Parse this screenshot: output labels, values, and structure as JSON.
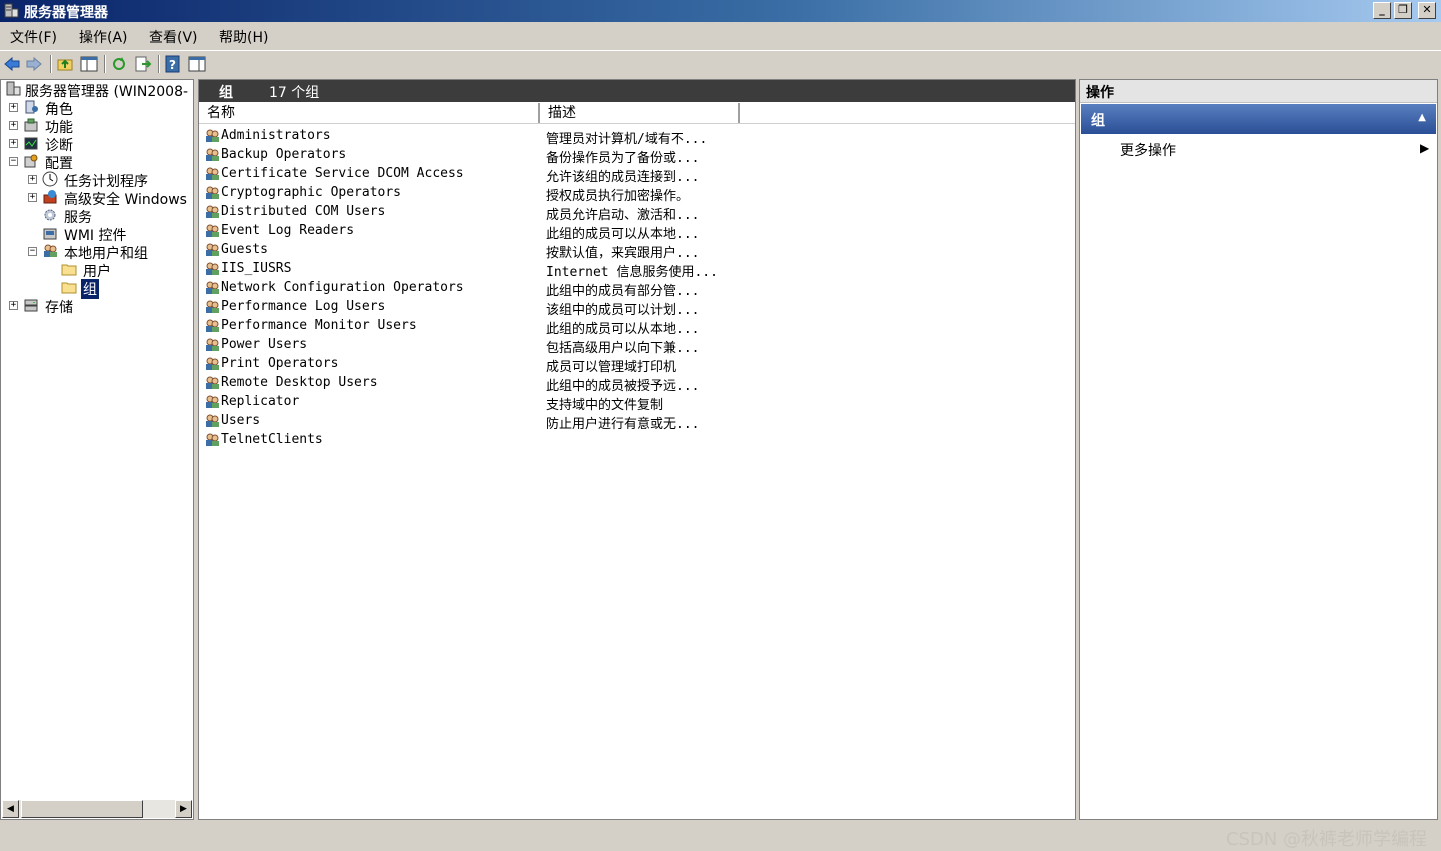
{
  "window": {
    "title": "服务器管理器",
    "buttons": [
      "_",
      "❐",
      "✕"
    ]
  },
  "menu": [
    "文件(F)",
    "操作(A)",
    "查看(V)",
    "帮助(H)"
  ],
  "toolbar_icons": [
    "back-icon",
    "forward-icon",
    "up-folder-icon",
    "show-hide-tree-icon",
    "refresh-icon",
    "export-list-icon",
    "help-icon",
    "show-hide-action-pane-icon"
  ],
  "tree": {
    "root": "服务器管理器 (WIN2008-",
    "items": [
      {
        "label": "角色",
        "expander": "+"
      },
      {
        "label": "功能",
        "expander": "+"
      },
      {
        "label": "诊断",
        "expander": "+"
      },
      {
        "label": "配置",
        "expander": "−"
      },
      {
        "label": "任务计划程序",
        "expander": "+"
      },
      {
        "label": "高级安全 Windows",
        "expander": "+"
      },
      {
        "label": "服务"
      },
      {
        "label": "WMI 控件"
      },
      {
        "label": "本地用户和组",
        "expander": "−"
      },
      {
        "label": "用户"
      },
      {
        "label": "组",
        "selected": true
      },
      {
        "label": "存储",
        "expander": "+"
      }
    ]
  },
  "center": {
    "title": "组",
    "count": "17 个组",
    "columns": [
      "名称",
      "描述"
    ],
    "rows": [
      {
        "name": "Administrators",
        "desc": "管理员对计算机/域有不..."
      },
      {
        "name": "Backup Operators",
        "desc": "备份操作员为了备份或..."
      },
      {
        "name": "Certificate Service DCOM Access",
        "desc": "允许该组的成员连接到..."
      },
      {
        "name": "Cryptographic Operators",
        "desc": "授权成员执行加密操作。"
      },
      {
        "name": "Distributed COM Users",
        "desc": "成员允许启动、激活和..."
      },
      {
        "name": "Event Log Readers",
        "desc": "此组的成员可以从本地..."
      },
      {
        "name": "Guests",
        "desc": "按默认值，来宾跟用户..."
      },
      {
        "name": "IIS_IUSRS",
        "desc": "Internet 信息服务使用..."
      },
      {
        "name": "Network Configuration Operators",
        "desc": "此组中的成员有部分管..."
      },
      {
        "name": "Performance Log Users",
        "desc": "该组中的成员可以计划..."
      },
      {
        "name": "Performance Monitor Users",
        "desc": "此组的成员可以从本地..."
      },
      {
        "name": "Power Users",
        "desc": "包括高级用户以向下兼..."
      },
      {
        "name": "Print Operators",
        "desc": "成员可以管理域打印机"
      },
      {
        "name": "Remote Desktop Users",
        "desc": "此组中的成员被授予远..."
      },
      {
        "name": "Replicator",
        "desc": "支持域中的文件复制"
      },
      {
        "name": "Users",
        "desc": "防止用户进行有意或无..."
      },
      {
        "name": "TelnetClients",
        "desc": ""
      }
    ]
  },
  "actions": {
    "header": "操作",
    "section": "组",
    "section_toggle": "▲",
    "more": "更多操作",
    "more_arrow": "▶"
  },
  "watermark": "CSDN @秋裤老师学编程",
  "colors": {
    "titlebar_start": "#0a246a",
    "selection": "#0a246a",
    "action_section": "#2a4f96"
  }
}
